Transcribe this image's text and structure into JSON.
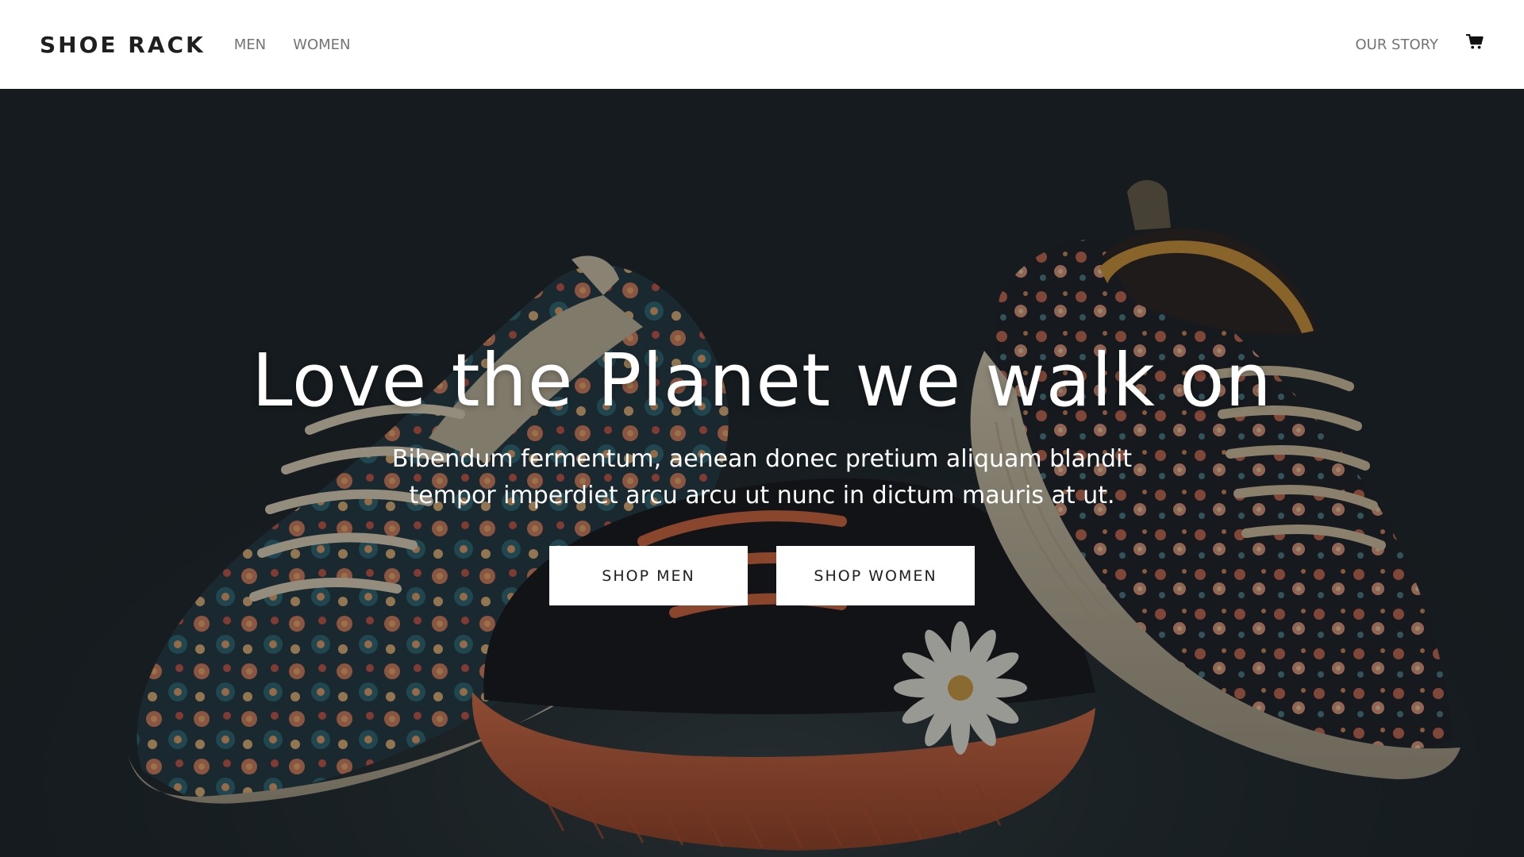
{
  "header": {
    "brand": "SHOE RACK",
    "nav_left": [
      {
        "label": "MEN"
      },
      {
        "label": "WOMEN"
      }
    ],
    "nav_right": [
      {
        "label": "OUR STORY"
      }
    ],
    "cart_icon": "shopping-cart-icon"
  },
  "hero": {
    "title": "Love the Planet we walk on",
    "subtitle": "Bibendum fermentum, aenean donec pretium aliquam blandit tempor imperdiet arcu arcu ut nunc in dictum mauris at ut.",
    "buttons": [
      {
        "label": "SHOP MEN"
      },
      {
        "label": "SHOP WOMEN"
      }
    ],
    "background_image": "three-floral-sneakers-photo"
  },
  "colors": {
    "nav_bg": "#ffffff",
    "brand_text": "#1f1f1f",
    "nav_link": "#747474",
    "hero_text": "#ffffff",
    "button_bg": "#ffffff",
    "button_text": "#1f1f1f",
    "hero_bg": "#1c2428"
  }
}
